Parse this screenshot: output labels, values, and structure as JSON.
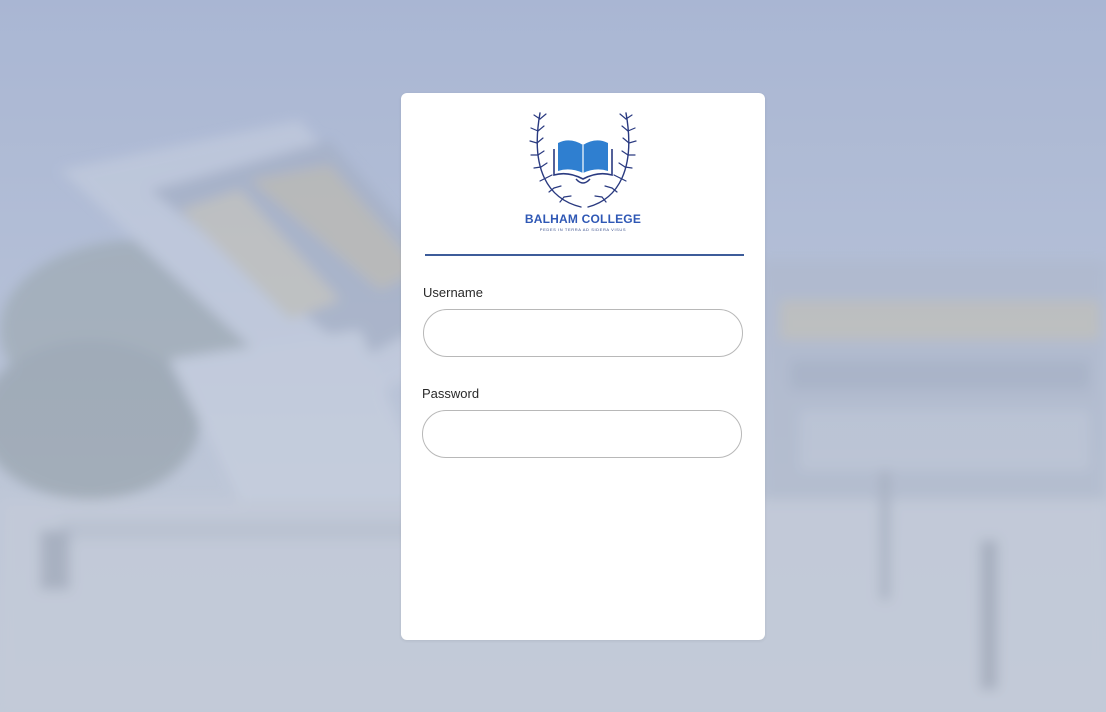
{
  "logo": {
    "name": "BALHAM COLLEGE",
    "motto": "PEDES IN TERRA AD SIDERA VISUS",
    "brand_color": "#2f58b5",
    "book_color": "#2f7fd0",
    "wreath_color": "#2a3a80"
  },
  "form": {
    "username": {
      "label": "Username",
      "value": ""
    },
    "password": {
      "label": "Password",
      "value": ""
    }
  },
  "colors": {
    "divider": "#3d5c9a",
    "background_tint": "#aab6d3"
  }
}
